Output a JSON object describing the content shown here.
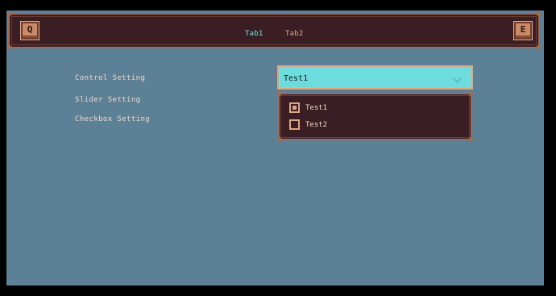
{
  "tabs": [
    {
      "label": "Tab1",
      "active": true
    },
    {
      "label": "Tab2",
      "active": false
    }
  ],
  "keys": {
    "left": "Q",
    "right": "E"
  },
  "settings": {
    "control_label": "Control Setting",
    "slider_label": "Slider Setting",
    "checkbox_label": "Checkbox Setting"
  },
  "select": {
    "value": "Test1",
    "options": [
      {
        "label": "Test1",
        "checked": true
      },
      {
        "label": "Test2",
        "checked": false
      }
    ]
  },
  "colors": {
    "background": "#5c8096",
    "panel": "#3b1e24",
    "border": "#a16a55",
    "accent_cyan": "#6cdcdc",
    "text": "#f0d9c8"
  }
}
